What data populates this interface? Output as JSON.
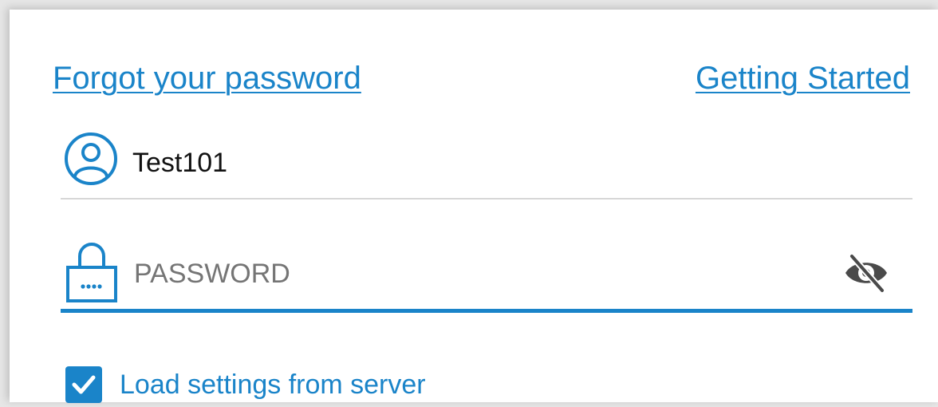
{
  "links": {
    "forgot_password": "Forgot your password",
    "getting_started": "Getting Started"
  },
  "username_field": {
    "value": "Test101",
    "icon": "user-circle-icon"
  },
  "password_field": {
    "placeholder": "PASSWORD",
    "value": "",
    "icon": "lock-icon",
    "visibility_icon": "eye-off-icon"
  },
  "load_settings": {
    "label": "Load settings from server",
    "checked": true
  },
  "colors": {
    "accent": "#1a84c9",
    "divider": "#d7d7d7",
    "eye_icon": "#4a4a4a"
  }
}
